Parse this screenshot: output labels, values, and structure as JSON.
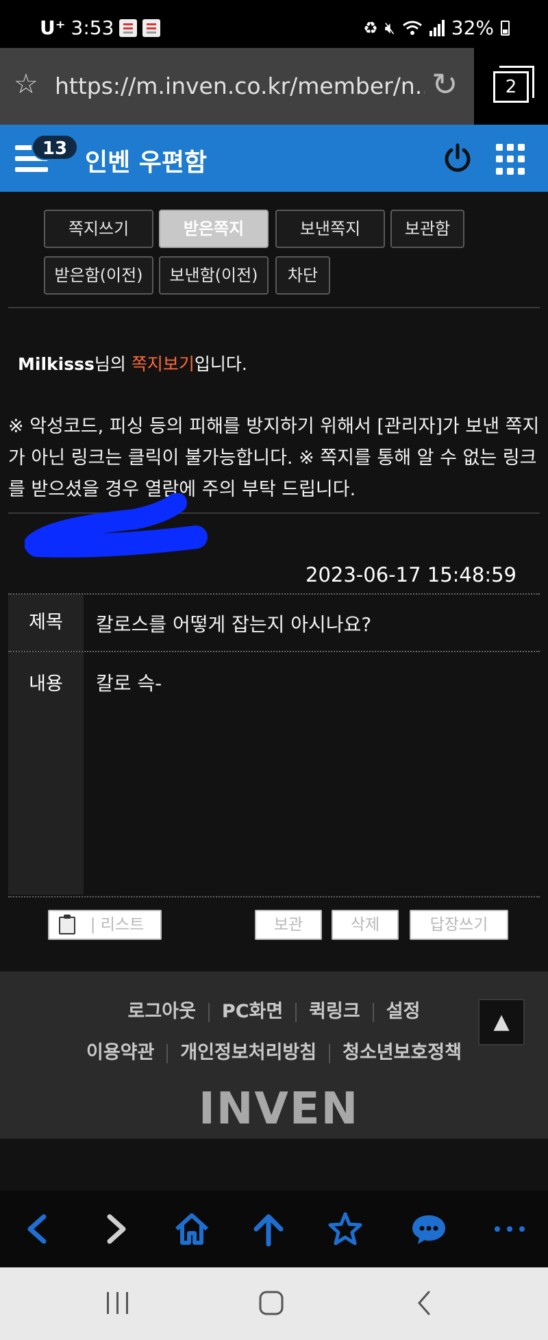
{
  "status_bar": {
    "carrier": "U⁺",
    "time": "3:53",
    "battery": "32%"
  },
  "browser": {
    "url": "https://m.inven.co.kr/member/n...",
    "tab_count": "2"
  },
  "header": {
    "notification_count": "13",
    "title": "인벤 우편함"
  },
  "tabs": [
    {
      "label": "쪽지쓰기",
      "active": false
    },
    {
      "label": "받은쪽지",
      "active": true
    },
    {
      "label": "보낸쪽지",
      "active": false
    },
    {
      "label": "보관함",
      "active": false
    },
    {
      "label": "받은함(이전)",
      "active": false
    },
    {
      "label": "보낸함(이전)",
      "active": false
    },
    {
      "label": "차단",
      "active": false
    }
  ],
  "owner": {
    "username": "Milkisss",
    "suffix_1": "님의 ",
    "highlight": "쪽지보기",
    "suffix_2": "입니다."
  },
  "notice": "※ 악성코드, 피싱 등의 피해를 방지하기 위해서 [관리자]가 보낸 쪽지가 아닌 링크는 클릭이 불가능합니다. ※ 쪽지를 통해 알 수 없는 링크를 받으셨을 경우 열람에 주의 부탁 드립니다.",
  "message": {
    "date": "2023-06-17 15:48:59",
    "subject_label": "제목",
    "subject": "칼로스를 어떻게 잡는지 아시나요?",
    "content_label": "내용",
    "content": "칼로 슥-"
  },
  "actions": {
    "list": "리스트",
    "keep": "보관",
    "delete": "삭제",
    "reply": "답장쓰기"
  },
  "footer": {
    "row1": [
      "로그아웃",
      "PC화면",
      "퀵링크",
      "설정"
    ],
    "row2": [
      "이용약관",
      "개인정보처리방침",
      "청소년보호정책"
    ],
    "logo": "INVEN"
  },
  "colors": {
    "header_blue": "#1e7bcf",
    "highlight_orange": "#ff6a3a",
    "browser_icon_blue": "#1f6fd1",
    "redaction_blue": "#0a2cff"
  }
}
